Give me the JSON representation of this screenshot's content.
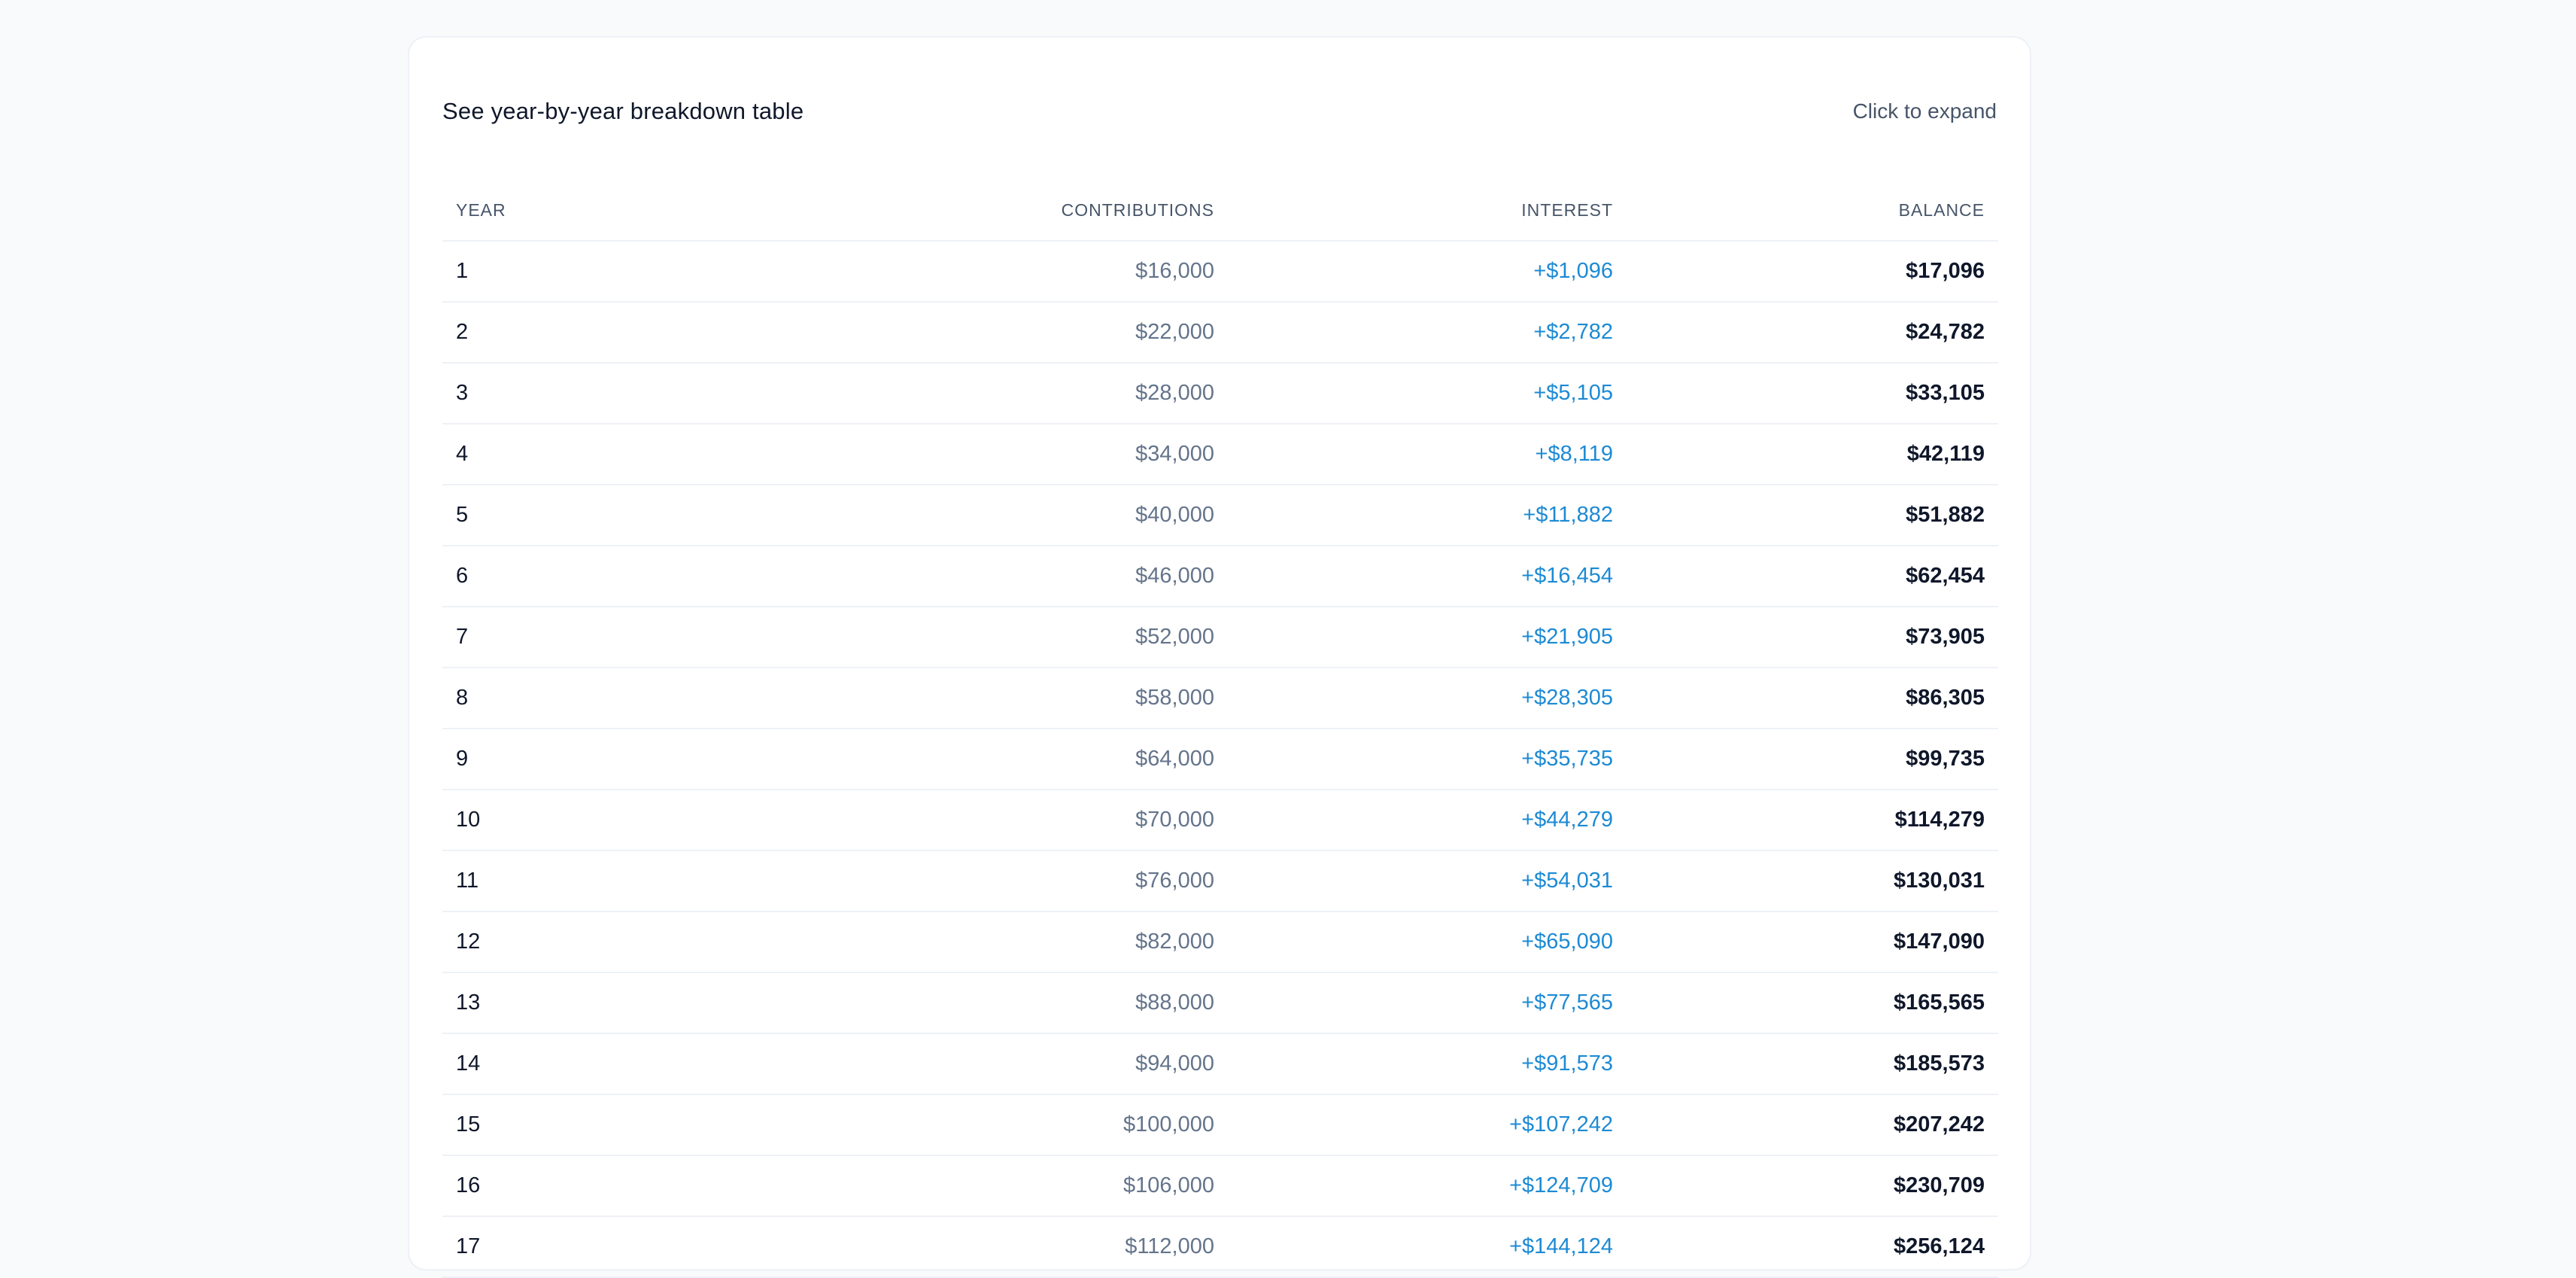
{
  "breakdown": {
    "title": "See year-by-year breakdown table",
    "toggle_label": "Click to expand"
  },
  "table": {
    "headers": {
      "year": "YEAR",
      "contributions": "CONTRIBUTIONS",
      "interest": "INTEREST",
      "balance": "BALANCE"
    },
    "rows": [
      {
        "year": "1",
        "contributions": "$16,000",
        "interest": "+$1,096",
        "balance": "$17,096"
      },
      {
        "year": "2",
        "contributions": "$22,000",
        "interest": "+$2,782",
        "balance": "$24,782"
      },
      {
        "year": "3",
        "contributions": "$28,000",
        "interest": "+$5,105",
        "balance": "$33,105"
      },
      {
        "year": "4",
        "contributions": "$34,000",
        "interest": "+$8,119",
        "balance": "$42,119"
      },
      {
        "year": "5",
        "contributions": "$40,000",
        "interest": "+$11,882",
        "balance": "$51,882"
      },
      {
        "year": "6",
        "contributions": "$46,000",
        "interest": "+$16,454",
        "balance": "$62,454"
      },
      {
        "year": "7",
        "contributions": "$52,000",
        "interest": "+$21,905",
        "balance": "$73,905"
      },
      {
        "year": "8",
        "contributions": "$58,000",
        "interest": "+$28,305",
        "balance": "$86,305"
      },
      {
        "year": "9",
        "contributions": "$64,000",
        "interest": "+$35,735",
        "balance": "$99,735"
      },
      {
        "year": "10",
        "contributions": "$70,000",
        "interest": "+$44,279",
        "balance": "$114,279"
      },
      {
        "year": "11",
        "contributions": "$76,000",
        "interest": "+$54,031",
        "balance": "$130,031"
      },
      {
        "year": "12",
        "contributions": "$82,000",
        "interest": "+$65,090",
        "balance": "$147,090"
      },
      {
        "year": "13",
        "contributions": "$88,000",
        "interest": "+$77,565",
        "balance": "$165,565"
      },
      {
        "year": "14",
        "contributions": "$94,000",
        "interest": "+$91,573",
        "balance": "$185,573"
      },
      {
        "year": "15",
        "contributions": "$100,000",
        "interest": "+$107,242",
        "balance": "$207,242"
      },
      {
        "year": "16",
        "contributions": "$106,000",
        "interest": "+$124,709",
        "balance": "$230,709"
      },
      {
        "year": "17",
        "contributions": "$112,000",
        "interest": "+$144,124",
        "balance": "$256,124"
      }
    ]
  }
}
